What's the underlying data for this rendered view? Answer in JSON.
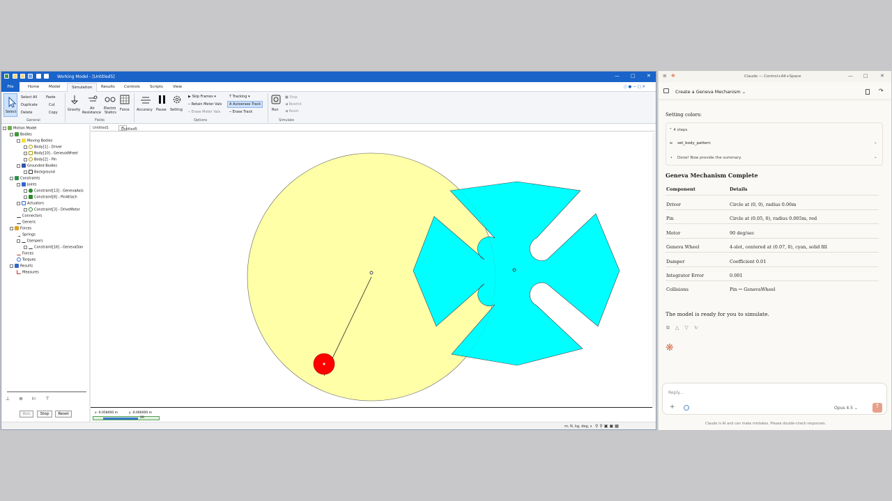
{
  "wm": {
    "title": "Working Model - [Untitled5]",
    "tabs": [
      "File",
      "Home",
      "Model",
      "Simulation",
      "Results",
      "Controls",
      "Scripts",
      "View"
    ],
    "ribbon": {
      "select": "Select",
      "select_all": "Select All",
      "paste": "Paste",
      "duplicate": "Duplicate",
      "cut": "Cut",
      "delete": "Delete",
      "copy": "Copy",
      "gravity": "Gravity",
      "air": "Air",
      "resistance": "Resistance",
      "electro": "Electro",
      "statics": "Statics",
      "force": "Force",
      "accuracy": "Accuracy",
      "pause": "Pause",
      "setting": "Setting",
      "skip_frames": "Skip Frames",
      "retain_meter": "Retain Meter Vals",
      "erase_meter": "Erase Meter Vals",
      "tracking": "Tracking",
      "autoerase": "Autoerase Track",
      "erase_track": "Erase Track",
      "run": "Run",
      "stop": "Stop",
      "rewind": "Rewind",
      "reset": "Reset",
      "groups": [
        "General",
        "Fields",
        "Options",
        "Simulate"
      ]
    },
    "tree": [
      "Motion Model",
      "Bodies",
      "Moving Bodies",
      "Body[1] - Driver",
      "Body[10] - GenevaWheel",
      "Body[2] - Pin",
      "Grounded Bodies",
      "Background",
      "Constraints",
      "Joints",
      "Constraint[13] - GenevaAxis",
      "Constraint[8] - PinAttach",
      "Actuators",
      "Constraint[3] - DriveMotor",
      "Connectors",
      "Generic",
      "Forces",
      "Springs",
      "Dampers",
      "Constraint[16] - GenevaDan",
      "Forces",
      "Torques",
      "Results",
      "Measures"
    ],
    "doc_tabs": [
      "Untitled1",
      "Untitled5"
    ],
    "controls": {
      "run": "Run",
      "stop": "Stop",
      "reset": "Reset"
    },
    "coords": {
      "x": "-0.058000",
      "y": "-0.066000",
      "unit": "m",
      "frame": "20"
    },
    "units": "m, N, kg, deg, s"
  },
  "claude": {
    "window_title": "Claude — Control+Alt+Space",
    "chat_title": "Create a Geneva Mechanism",
    "setting_colors": "Setting colors:",
    "steps_count": "4 steps",
    "step_tool": "set_body_pattern",
    "step_done": "Done! Now provide the summary.",
    "summary_title": "Geneva Mechanism Complete",
    "table_headers": [
      "Component",
      "Details"
    ],
    "table_rows": [
      [
        "Driver",
        "Circle at (0, 0), radius 0.06m"
      ],
      [
        "Pin",
        "Circle at (0.05, 0), radius 0.005m, red"
      ],
      [
        "Motor",
        "90 deg/sec"
      ],
      [
        "Geneva Wheel",
        "4-slot, centered at (0.07, 0), cyan, solid fill"
      ],
      [
        "Damper",
        "Coefficient 0.01"
      ],
      [
        "Integrator Error",
        "0.001"
      ],
      [
        "Collisions",
        "Pin ↔ GenevaWheel"
      ]
    ],
    "ready": "The model is ready for you to simulate.",
    "reply_placeholder": "Reply...",
    "model": "Opus 4.5",
    "disclaimer": "Claude is AI and can make mistakes. Please double-check responses."
  },
  "colors": {
    "driver": "#ffffa8",
    "wheel": "#00ffff",
    "pin": "#ff0000",
    "accent": "#1a63c9",
    "claude_orange": "#d97757"
  }
}
